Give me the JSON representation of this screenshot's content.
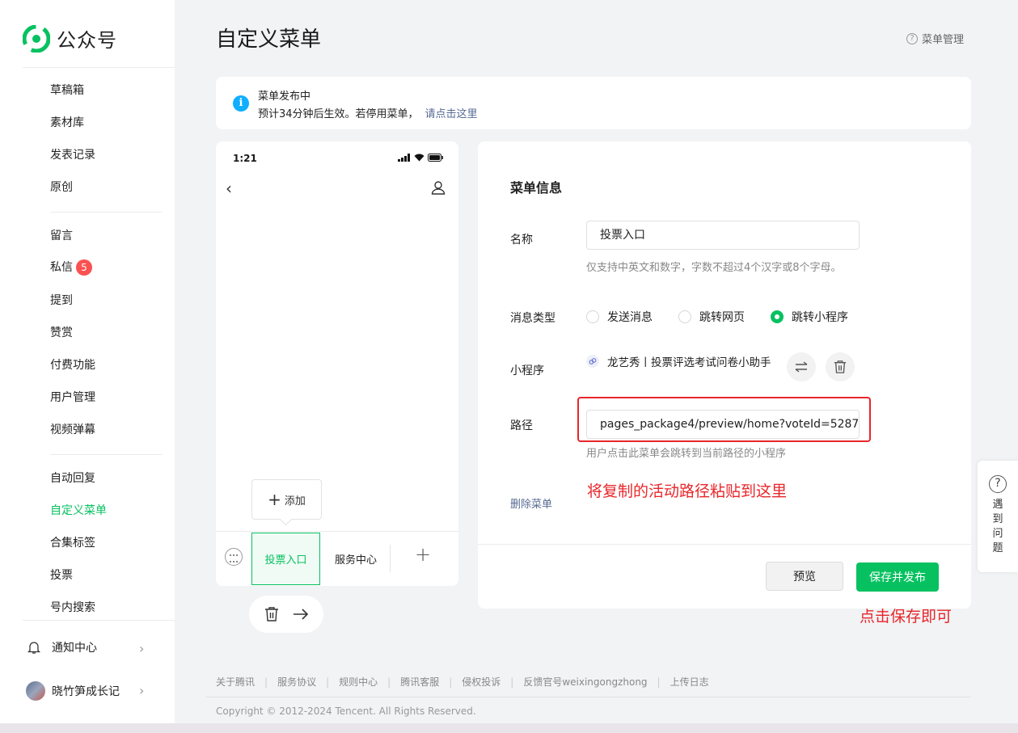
{
  "app": {
    "brand": "公众号"
  },
  "sidebar": {
    "group1": [
      "草稿箱",
      "素材库",
      "发表记录",
      "原创"
    ],
    "group2": [
      {
        "label": "留言"
      },
      {
        "label": "私信",
        "badge": "5"
      },
      {
        "label": "提到"
      },
      {
        "label": "赞赏"
      },
      {
        "label": "付费功能"
      },
      {
        "label": "用户管理"
      },
      {
        "label": "视频弹幕"
      }
    ],
    "group3": [
      "自动回复",
      "自定义菜单",
      "合集标签",
      "投票",
      "号内搜索"
    ],
    "notify": "通知中心",
    "account": "晓竹笋成长记"
  },
  "header": {
    "title": "自定义菜单",
    "manage": "菜单管理"
  },
  "notice": {
    "title": "菜单发布中",
    "desc": "预计34分钟后生效。若停用菜单，",
    "link": "请点击这里"
  },
  "phone": {
    "time": "1:21",
    "add_label": "添加",
    "tabs": [
      "投票入口",
      "服务中心"
    ]
  },
  "form": {
    "section_title": "菜单信息",
    "name_label": "名称",
    "name_value": "投票入口",
    "name_hint": "仅支持中英文和数字，字数不超过4个汉字或8个字母。",
    "type_label": "消息类型",
    "types": [
      "发送消息",
      "跳转网页",
      "跳转小程序"
    ],
    "selected_type": "跳转小程序",
    "mp_label": "小程序",
    "mp_name": "龙艺秀丨投票评选考试问卷小助手",
    "path_label": "路径",
    "path_value": "pages_package4/preview/home?voteId=5287",
    "path_hint": "用户点击此菜单会跳转到当前路径的小程序",
    "delete": "删除菜单",
    "preview_btn": "预览",
    "save_btn": "保存并发布"
  },
  "annotations": {
    "paste": "将复制的活动路径粘贴到这里",
    "save": "点击保存即可"
  },
  "help": {
    "label": "遇到问题"
  },
  "footer": {
    "links": [
      "关于腾讯",
      "服务协议",
      "规则中心",
      "腾讯客服",
      "侵权投诉",
      "反馈官号weixingongzhong",
      "上传日志"
    ],
    "copyright": "Copyright © 2012-2024 Tencent. All Rights Reserved."
  },
  "colors": {
    "accent": "#07c160",
    "link": "#576b95",
    "annotation": "#e8262a",
    "badge": "#fa5151",
    "info": "#10aeff"
  }
}
